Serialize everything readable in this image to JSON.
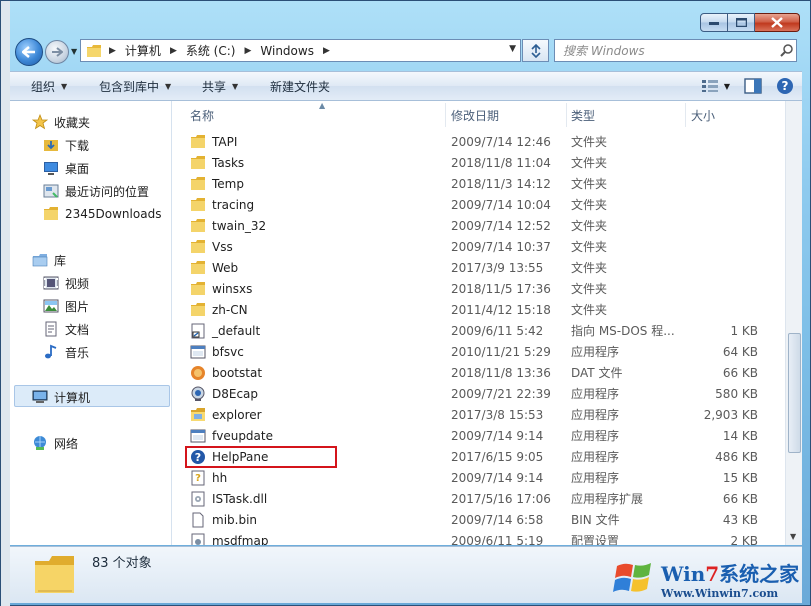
{
  "window": {
    "title_hint": "计算机",
    "controls": {
      "minimize": "minimize",
      "maximize": "maximize",
      "close": "close"
    }
  },
  "address_bar": {
    "crumbs": [
      "计算机",
      "系统 (C:)",
      "Windows"
    ]
  },
  "search": {
    "placeholder": "搜索 Windows"
  },
  "toolbar": {
    "organize": "组织",
    "include_library": "包含到库中",
    "share": "共享",
    "new_folder": "新建文件夹"
  },
  "nav": {
    "favorites": "收藏夹",
    "downloads": "下载",
    "desktop": "桌面",
    "recent": "最近访问的位置",
    "downloads2345": "2345Downloads",
    "libraries": "库",
    "videos": "视频",
    "pictures": "图片",
    "documents": "文档",
    "music": "音乐",
    "computer": "计算机",
    "network": "网络"
  },
  "columns": {
    "name": "名称",
    "date": "修改日期",
    "type": "类型",
    "size": "大小"
  },
  "files": [
    {
      "name": "TAPI",
      "date": "2009/7/14 12:46",
      "type": "文件夹",
      "size": "",
      "icon": "folder-icon"
    },
    {
      "name": "Tasks",
      "date": "2018/11/8 11:04",
      "type": "文件夹",
      "size": "",
      "icon": "folder-icon"
    },
    {
      "name": "Temp",
      "date": "2018/11/3 14:12",
      "type": "文件夹",
      "size": "",
      "icon": "folder-icon"
    },
    {
      "name": "tracing",
      "date": "2009/7/14 10:04",
      "type": "文件夹",
      "size": "",
      "icon": "folder-icon"
    },
    {
      "name": "twain_32",
      "date": "2009/7/14 12:52",
      "type": "文件夹",
      "size": "",
      "icon": "folder-icon"
    },
    {
      "name": "Vss",
      "date": "2009/7/14 10:37",
      "type": "文件夹",
      "size": "",
      "icon": "folder-icon"
    },
    {
      "name": "Web",
      "date": "2017/3/9 13:55",
      "type": "文件夹",
      "size": "",
      "icon": "folder-icon"
    },
    {
      "name": "winsxs",
      "date": "2018/11/5 17:36",
      "type": "文件夹",
      "size": "",
      "icon": "folder-icon"
    },
    {
      "name": "zh-CN",
      "date": "2011/4/12 15:18",
      "type": "文件夹",
      "size": "",
      "icon": "folder-icon"
    },
    {
      "name": "_default",
      "date": "2009/6/11 5:42",
      "type": "指向 MS-DOS 程...",
      "size": "1 KB",
      "icon": "shortcut-icon"
    },
    {
      "name": "bfsvc",
      "date": "2010/11/21 5:29",
      "type": "应用程序",
      "size": "64 KB",
      "icon": "exe-icon"
    },
    {
      "name": "bootstat",
      "date": "2018/11/8 13:36",
      "type": "DAT 文件",
      "size": "66 KB",
      "icon": "dat-icon"
    },
    {
      "name": "D8Ecap",
      "date": "2009/7/21 22:39",
      "type": "应用程序",
      "size": "580 KB",
      "icon": "webcam-icon"
    },
    {
      "name": "explorer",
      "date": "2017/3/8 15:53",
      "type": "应用程序",
      "size": "2,903 KB",
      "icon": "explorer-icon"
    },
    {
      "name": "fveupdate",
      "date": "2009/7/14 9:14",
      "type": "应用程序",
      "size": "14 KB",
      "icon": "exe-icon"
    },
    {
      "name": "HelpPane",
      "date": "2017/6/15 9:05",
      "type": "应用程序",
      "size": "486 KB",
      "icon": "help-icon"
    },
    {
      "name": "hh",
      "date": "2009/7/14 9:14",
      "type": "应用程序",
      "size": "15 KB",
      "icon": "hh-icon"
    },
    {
      "name": "ISTask.dll",
      "date": "2017/5/16 17:06",
      "type": "应用程序扩展",
      "size": "66 KB",
      "icon": "dll-icon"
    },
    {
      "name": "mib.bin",
      "date": "2009/7/14 6:58",
      "type": "BIN 文件",
      "size": "43 KB",
      "icon": "file-icon"
    },
    {
      "name": "msdfmap",
      "date": "2009/6/11 5:19",
      "type": "配置设置",
      "size": "2 KB",
      "icon": "ini-icon"
    }
  ],
  "details": {
    "count": "83 个对象"
  },
  "watermark": {
    "title_a": "Win",
    "title_b": "7",
    "title_c": "系统之家",
    "url": "Www.Winwin7.com"
  },
  "colors": {
    "highlight_border": "#d4141b",
    "folder": "#f2c94c"
  }
}
